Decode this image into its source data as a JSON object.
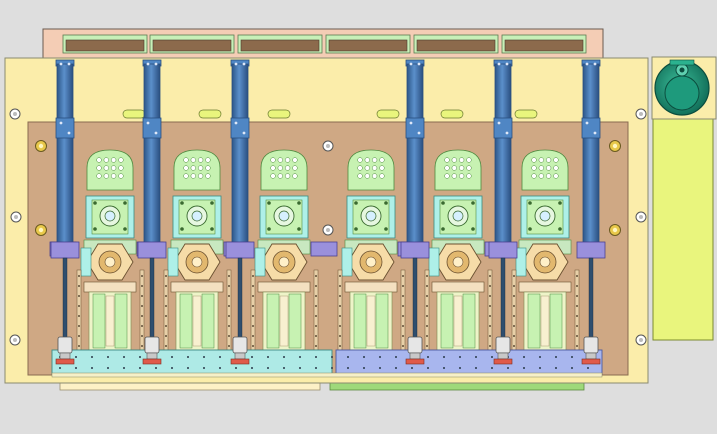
{
  "scene": {
    "background": "#dedede",
    "colors": {
      "frame": "#fbedaa",
      "frame_edge": "#8a8a70",
      "plate": "#cfa884",
      "plate_edge": "#8a6a50",
      "top_rail": "#f4cdb5",
      "top_slot": "#8c6a4c",
      "top_slot_edge": "#c8f0b8",
      "cylinder": "#3f72ae",
      "cylinder_dark": "#2a4f80",
      "cylinder_cap": "#4f86c4",
      "pad_green": "#c7f2b2",
      "pad_cyan": "#aef0e8",
      "bracket_purple": "#9a90dc",
      "base_cyan": "#aeeae6",
      "base_blue": "#a8b6ee",
      "motor_green": "#1e9a7c",
      "motor_dark": "#0f6a55",
      "side_yellow": "#e9f57d",
      "bottom_green": "#9ed97a",
      "bottom_cream": "#fdf1c6",
      "rod": "#2f4e6e"
    },
    "icons": [
      "vacuum-cup-icon",
      "servo-motor-icon",
      "bolt-hole-icon"
    ]
  }
}
